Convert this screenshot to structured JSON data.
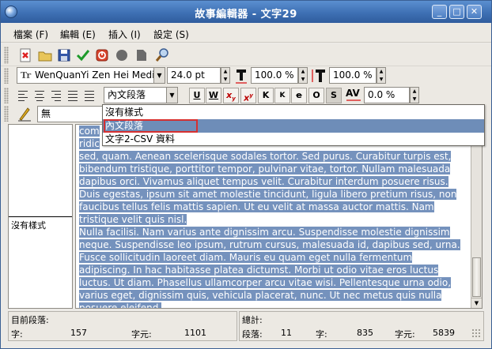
{
  "window": {
    "title": "故事編輯器 - 文字29",
    "min": "_",
    "max": "□",
    "close": "✕"
  },
  "menu": [
    "檔案 (F)",
    "編輯 (E)",
    "插入 (I)",
    "設定 (S)"
  ],
  "toolbar_icons": [
    "new-doc-icon",
    "open-folder-icon",
    "save-icon",
    "check-icon",
    "reload-icon",
    "circle-icon",
    "folder-icon",
    "search-icon"
  ],
  "font": {
    "family": "WenQuanYi Zen Hei Mediu",
    "size": "24.0 pt",
    "scale_h": "100.0 %",
    "scale_v": "100.0 %",
    "tracking": "0.0 %"
  },
  "paragraph_style": {
    "current": "內文段落"
  },
  "char_style": {
    "current": "無"
  },
  "dropdown": {
    "items": [
      "沒有樣式",
      "內文段落",
      "文字2-CSV 資料"
    ],
    "selected_index": 1
  },
  "left_panel": {
    "label": "沒有樣式"
  },
  "text": {
    "lines": [
      "com",
      "ridic",
      "sed, quam. Aenean scelerisque sodales tortor. Sed purus. Curabitur turpis est,",
      "bibendum tristique, porttitor tempor, pulvinar vitae, tortor. Nullam malesuada",
      "dapibus orci. Vivamus aliquet tempus velit. Curabitur interdum posuere risus.",
      "Duis egestas, ipsum sit amet molestie tincidunt, ligula libero pretium risus, non",
      "faucibus tellus felis mattis sapien. Ut eu velit at massa auctor mattis. Nam",
      "tristique velit quis nisl.",
      "Nulla facilisi. Nam varius ante dignissim arcu. Suspendisse molestie dignissim",
      "neque. Suspendisse leo ipsum, rutrum cursus, malesuada id, dapibus sed, urna.",
      "Fusce sollicitudin laoreet diam. Mauris eu quam eget nulla fermentum",
      "adipiscing. In hac habitasse platea dictumst. Morbi ut odio vitae eros luctus",
      "luctus. Ut diam. Phasellus ullamcorper arcu vitae wisi. Pellentesque urna odio,",
      "varius eget, dignissim quis, vehicula placerat, nunc. Ut nec metus quis nulla",
      "posuere eleifend."
    ]
  },
  "status": {
    "current_para_label": "目前段落:",
    "chars_label": "字:",
    "chars_value": "157",
    "charcount_label": "字元:",
    "charcount_value": "1101",
    "total_label": "總計:",
    "paras_label": "段落:",
    "paras_value": "11",
    "words_label": "字:",
    "words_value": "835",
    "total_chars_label": "字元:",
    "total_chars_value": "5839"
  },
  "colors": {
    "selection": "#7592bd",
    "titlebar": "#3e70b4",
    "highlight_outline": "#d63030"
  }
}
